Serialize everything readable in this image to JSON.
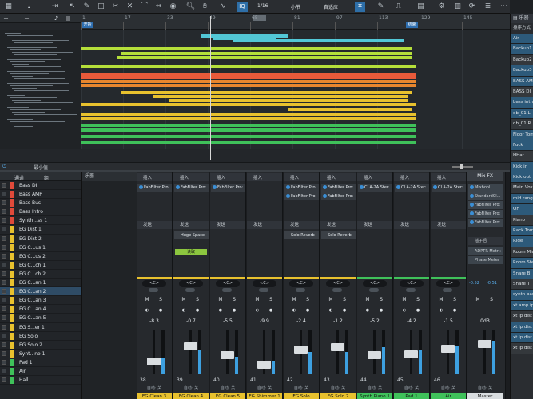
{
  "toolbar": {
    "quantize_value": "1/16",
    "timebase": "小节",
    "snap_mode": "自适应",
    "iq_label": "IQ"
  },
  "arrange": {
    "ruler_bars": [
      "1",
      "17",
      "33",
      "49",
      "65",
      "81",
      "97",
      "113",
      "129",
      "145"
    ],
    "marker_start": "开始",
    "marker_end": "结束",
    "zoom_label": "最小值"
  },
  "browser": {
    "tab": "乐器",
    "sort_label": "排序方式",
    "items": [
      "Air",
      "Backup1",
      "Backup2",
      "Backup3",
      "BASS AMP",
      "BASS DI",
      "bass intro",
      "db_01.L",
      "db_01.R",
      "Floor Tom",
      "Fuck",
      "HHat",
      "Kick in",
      "Kick out",
      "Main Vox",
      "mid range",
      "OH",
      "Piano",
      "Rack Tom",
      "Ride",
      "Room Mic",
      "Room Ster",
      "Snare B",
      "Snare T",
      "synth bass",
      "xt amp ip",
      "xt lp dist",
      "xt lp dist",
      "xt lp dist",
      "xt lp dist"
    ]
  },
  "console": {
    "list_header_channels": "通道",
    "list_header_group": "组",
    "list_header_instrument": "乐器",
    "channels": [
      {
        "name": "Bass DI",
        "color": "#e04a3a"
      },
      {
        "name": "Bass AMP",
        "color": "#e04a3a"
      },
      {
        "name": "Bass Bus",
        "color": "#e04a3a"
      },
      {
        "name": "Bass Intro",
        "color": "#e04a3a"
      },
      {
        "name": "Synth...ss 1",
        "color": "#e04a3a"
      },
      {
        "name": "EG Dist 1",
        "color": "#e8c12e"
      },
      {
        "name": "EG Dist 2",
        "color": "#e8c12e"
      },
      {
        "name": "EG C...us 1",
        "color": "#e8c12e"
      },
      {
        "name": "EG C...us 2",
        "color": "#e8c12e"
      },
      {
        "name": "EG C...ch 1",
        "color": "#e8c12e"
      },
      {
        "name": "EG C...ch 2",
        "color": "#e8c12e"
      },
      {
        "name": "EG C...an 1",
        "color": "#e8c12e"
      },
      {
        "name": "EG C...an 2",
        "color": "#e8c12e"
      },
      {
        "name": "EG C...an 3",
        "color": "#e8c12e"
      },
      {
        "name": "EG C...an 4",
        "color": "#e8c12e"
      },
      {
        "name": "EG C...an 5",
        "color": "#e8c12e"
      },
      {
        "name": "EG S...er 1",
        "color": "#e8c12e"
      },
      {
        "name": "EG Solo",
        "color": "#e8c12e"
      },
      {
        "name": "EG Solo 2",
        "color": "#e8c12e"
      },
      {
        "name": "Synt...no 1",
        "color": "#e8c12e"
      },
      {
        "name": "Pad 1",
        "color": "#3fc15a"
      },
      {
        "name": "Air",
        "color": "#3fc15a"
      },
      {
        "name": "Hall",
        "color": "#3fc15a"
      }
    ],
    "insert_label": "插入",
    "send_label": "发送",
    "strips": [
      {
        "label": "EG Clean 3",
        "num": "38",
        "vol": "-8.3",
        "inserts": [
          "FabFilter Pro:"
        ],
        "sends": [],
        "label_color": "#e8c12e",
        "level": 0.28,
        "meter": 0.35,
        "auto": "自动: 关"
      },
      {
        "label": "EG Clean 4",
        "num": "39",
        "vol": "-0.7",
        "inserts": [
          "FabFilter Pro:"
        ],
        "sends": [
          "Huge Space"
        ],
        "label_color": "#e8c12e",
        "level": 0.62,
        "meter": 0.55,
        "auto": "自动: 关",
        "tag": "读取"
      },
      {
        "label": "EG Clean 5",
        "num": "40",
        "vol": "-5.5",
        "inserts": [
          "FabFilter Pro:"
        ],
        "sends": [],
        "label_color": "#e8c12e",
        "level": 0.42,
        "meter": 0.4,
        "auto": "自动: 关"
      },
      {
        "label": "EG Shimmer 1",
        "num": "41",
        "vol": "-9.9",
        "inserts": [],
        "sends": [],
        "label_color": "#e8c12e",
        "level": 0.22,
        "meter": 0.3,
        "auto": "自动: 关"
      },
      {
        "label": "EG Solo",
        "num": "42",
        "vol": "-2.4",
        "inserts": [
          "FabFilter Pro:",
          "FabFilter Pro:"
        ],
        "sends": [
          "Solo Reverb"
        ],
        "label_color": "#e8c12e",
        "level": 0.55,
        "meter": 0.5,
        "auto": "自动: 关"
      },
      {
        "label": "EG Solo 2",
        "num": "43",
        "vol": "-1.2",
        "inserts": [
          "FabFilter Pro:",
          "FabFilter Pro:"
        ],
        "sends": [
          "Solo Reverb"
        ],
        "label_color": "#e8c12e",
        "level": 0.6,
        "meter": 0.5,
        "auto": "自动: 关"
      },
      {
        "label": "Synth Piano 1",
        "num": "44",
        "vol": "-5.2",
        "inserts": [
          "CLA-2A Ster:"
        ],
        "sends": [],
        "label_color": "#3fc15a",
        "level": 0.42,
        "meter": 0.6,
        "auto": "自动: 关"
      },
      {
        "label": "Pad 1",
        "num": "45",
        "vol": "-4.2",
        "inserts": [
          "CLA-2A Ster:"
        ],
        "sends": [],
        "label_color": "#3fc15a",
        "level": 0.45,
        "meter": 0.55,
        "auto": "自动: 关"
      },
      {
        "label": "Air",
        "num": "46",
        "vol": "-1.5",
        "inserts": [
          "CLA-2A Ster:"
        ],
        "sends": [],
        "label_color": "#3fc15a",
        "level": 0.58,
        "meter": 0.62,
        "auto": "自动: 关"
      }
    ],
    "master": {
      "label": "Master",
      "mixfx": "Mix FX",
      "fx": [
        "Mixbool",
        "StandardCl...",
        "FabFilter Pro:",
        "FabFilter Pro:",
        "FabFilter Pro:"
      ],
      "post_label": "插子后",
      "post_fx": [
        "ADPTR Metri:",
        "Phase Meter"
      ],
      "peak_l": "-0.52",
      "peak_r": "-0.51",
      "vol": "0dB",
      "level": 0.68,
      "meter": 0.75,
      "auto": "自动: 关"
    }
  }
}
